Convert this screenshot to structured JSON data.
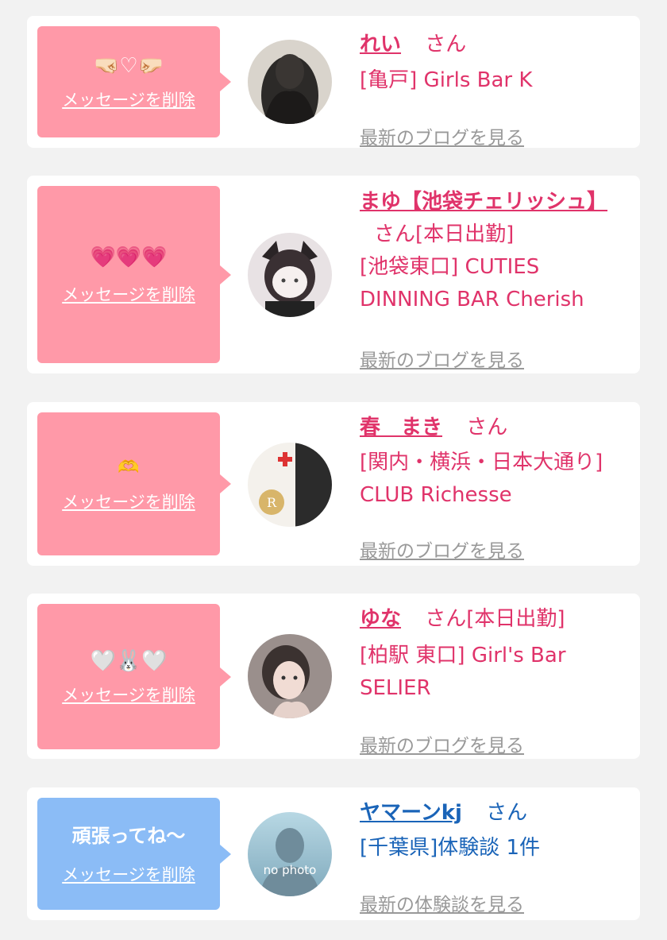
{
  "items": [
    {
      "message": "🤜🏻♡🤛🏻",
      "delete_label": "メッセージを削除",
      "name": "れい",
      "suffix": "さん",
      "shop": "[亀戸] Girls Bar K",
      "link": "最新のブログを見る"
    },
    {
      "message": "💗💗💗",
      "delete_label": "メッセージを削除",
      "name": "まゆ【池袋チェリッシュ】",
      "suffix": "さん[本日出勤]",
      "shop": "[池袋東口] CUTIES DINNING BAR Cherish",
      "link": "最新のブログを見る"
    },
    {
      "message": "🫶",
      "delete_label": "メッセージを削除",
      "name": "春　まき",
      "suffix": "さん",
      "shop": "[関内・横浜・日本大通り] CLUB Richesse",
      "link": "最新のブログを見る"
    },
    {
      "message": "🤍🐰🤍",
      "delete_label": "メッセージを削除",
      "name": "ゆな",
      "suffix": "さん[本日出勤]",
      "shop": "[柏駅 東口] Girl's Bar SELIER",
      "link": "最新のブログを見る"
    },
    {
      "message": "頑張ってね〜",
      "delete_label": "メッセージを削除",
      "name": "ヤマーンkj",
      "suffix": "さん",
      "shop": "[千葉県]体験談 1件",
      "link": "最新の体験談を見る",
      "avatar_text": "no photo"
    }
  ],
  "colors": {
    "pink": "#ff99a8",
    "blue": "#8bbcf6",
    "name_pink": "#e0336a",
    "name_blue": "#1a64b8"
  }
}
